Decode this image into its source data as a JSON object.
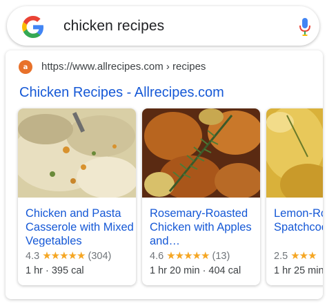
{
  "search": {
    "query": "chicken recipes"
  },
  "result": {
    "site_icon_text": "a",
    "url": "https://www.allrecipes.com › recipes",
    "title": "Chicken Recipes - Allrecipes.com"
  },
  "recipes": [
    {
      "name": "Chicken and Pasta Casserole with Mixed Vegetables",
      "rating": "4.3",
      "stars": "★★★★★",
      "reviews": "(304)",
      "meta": "1 hr · 395 cal"
    },
    {
      "name": "Rosemary-Roasted Chicken with Apples and…",
      "rating": "4.6",
      "stars": "★★★★★",
      "reviews": "(13)",
      "meta": "1 hr 20 min · 404 cal"
    },
    {
      "name": "Lemon-Rosemary Spatchcock Chicken",
      "rating": "2.5",
      "stars": "★★★",
      "reviews": "",
      "meta": "1 hr 25 min"
    }
  ],
  "colors": {
    "link": "#1558d6",
    "star": "#f5a623",
    "favicon": "#e8712a"
  }
}
